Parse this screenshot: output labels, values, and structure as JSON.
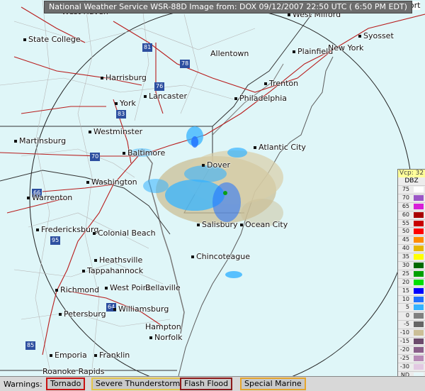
{
  "header": {
    "title": "National Weather Service WSR-88D Image from: DOX 09/12/2007  22:50 UTC ( 6:50 PM EDT)"
  },
  "map": {
    "cities": [
      {
        "id": "west-haven",
        "label": "West Haven"
      },
      {
        "id": "bridgeport",
        "label": "Bridgeport"
      },
      {
        "id": "west-milford",
        "label": "West Milford"
      },
      {
        "id": "state-college",
        "label": "State College"
      },
      {
        "id": "syosset",
        "label": "Syosset"
      },
      {
        "id": "allentown",
        "label": "Allentown"
      },
      {
        "id": "plainfield",
        "label": "Plainfield"
      },
      {
        "id": "new-york",
        "label": "New York"
      },
      {
        "id": "harrisburg",
        "label": "Harrisburg"
      },
      {
        "id": "trenton",
        "label": "Trenton"
      },
      {
        "id": "lancaster",
        "label": "Lancaster"
      },
      {
        "id": "philadelphia",
        "label": "Philadelphia"
      },
      {
        "id": "york",
        "label": "York"
      },
      {
        "id": "westminster",
        "label": "Westminster"
      },
      {
        "id": "martinsburg",
        "label": "Martinsburg"
      },
      {
        "id": "baltimore",
        "label": "Baltimore"
      },
      {
        "id": "atlantic-city",
        "label": "Atlantic City"
      },
      {
        "id": "dover",
        "label": "Dover"
      },
      {
        "id": "washington",
        "label": "Washington"
      },
      {
        "id": "warrenton",
        "label": "Warrenton"
      },
      {
        "id": "fredericksburg",
        "label": "Fredericksburg"
      },
      {
        "id": "colonial-beach",
        "label": "Colonial Beach"
      },
      {
        "id": "salisbury",
        "label": "Salisbury"
      },
      {
        "id": "ocean-city",
        "label": "Ocean City"
      },
      {
        "id": "chincoteague",
        "label": "Chincoteague"
      },
      {
        "id": "heathsville",
        "label": "Heathsville"
      },
      {
        "id": "tappahannock",
        "label": "Tappahannock"
      },
      {
        "id": "richmond",
        "label": "Richmond"
      },
      {
        "id": "west-point",
        "label": "West Point"
      },
      {
        "id": "belle-haven",
        "label": "Bellaville"
      },
      {
        "id": "petersburg",
        "label": "Petersburg"
      },
      {
        "id": "williamsburg",
        "label": "Williamsburg"
      },
      {
        "id": "hampton",
        "label": "Hampton"
      },
      {
        "id": "norfolk",
        "label": "Norfolk"
      },
      {
        "id": "emporia",
        "label": "Emporia"
      },
      {
        "id": "franklin",
        "label": "Franklin"
      },
      {
        "id": "roanoke-rapids",
        "label": "Roanoke Rapids"
      }
    ],
    "highways": [
      "81",
      "78",
      "76",
      "83",
      "70",
      "95",
      "66",
      "64",
      "85"
    ]
  },
  "legend": {
    "vcp_label": "Vcp: 32",
    "unit": "DBZ",
    "nd_label": "ND",
    "rows": [
      {
        "value": "75",
        "color": "#ffffff"
      },
      {
        "value": "70",
        "color": "#9b57c7"
      },
      {
        "value": "65",
        "color": "#d81fd8"
      },
      {
        "value": "60",
        "color": "#a80000"
      },
      {
        "value": "55",
        "color": "#c80000"
      },
      {
        "value": "50",
        "color": "#ff0000"
      },
      {
        "value": "45",
        "color": "#ff8c00"
      },
      {
        "value": "40",
        "color": "#e6b800"
      },
      {
        "value": "35",
        "color": "#ffff00"
      },
      {
        "value": "30",
        "color": "#006a00"
      },
      {
        "value": "25",
        "color": "#00a000"
      },
      {
        "value": "20",
        "color": "#00e000"
      },
      {
        "value": "15",
        "color": "#0000ff"
      },
      {
        "value": "10",
        "color": "#1f6fff"
      },
      {
        "value": "5",
        "color": "#35b3ff"
      },
      {
        "value": "0",
        "color": "#808080"
      },
      {
        "value": "-5",
        "color": "#666666"
      },
      {
        "value": "-10",
        "color": "#cbbf97"
      },
      {
        "value": "-15",
        "color": "#6b4a6b"
      },
      {
        "value": "-20",
        "color": "#8a5f8a"
      },
      {
        "value": "-25",
        "color": "#b78ab7"
      },
      {
        "value": "-30",
        "color": "#e2c9e2"
      }
    ]
  },
  "warnings": {
    "label": "Warnings:",
    "tornado": "Tornado",
    "severe": "Severe Thunderstorm",
    "flood": "Flash Flood",
    "marine": "Special Marine"
  }
}
